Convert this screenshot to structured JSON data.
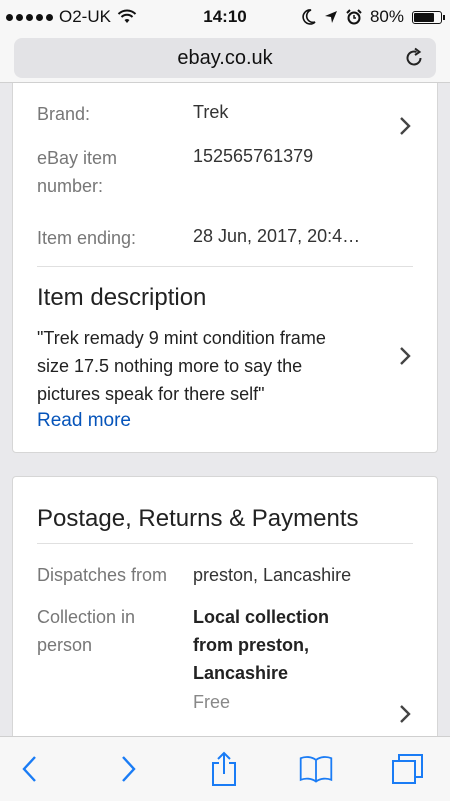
{
  "status": {
    "carrier": "O2-UK",
    "time": "14:10",
    "battery": "80%",
    "battery_level": 0.8
  },
  "browser": {
    "url": "ebay.co.uk"
  },
  "item_specifics": {
    "brand_label": "Brand:",
    "brand_value": "Trek",
    "item_number_label_line1": "eBay item",
    "item_number_label_line2": "number:",
    "item_number_value": "152565761379",
    "ending_label": "Item ending:",
    "ending_value": "28 Jun, 2017, 20:4…"
  },
  "description": {
    "title": "Item description",
    "line1": "\"Trek remady 9 mint condition frame",
    "line2": "size 17.5 nothing more to say the",
    "line3": "pictures speak for there self\"",
    "read_more": "Read more"
  },
  "postage": {
    "title": "Postage, Returns & Payments",
    "dispatch_label": "Dispatches from",
    "dispatch_value": "preston, Lancashire",
    "collection_label_line1": "Collection in",
    "collection_label_line2": "person",
    "collection_value_line1": "Local collection",
    "collection_value_line2": "from preston,",
    "collection_value_line3": "Lancashire",
    "collection_price": "Free"
  },
  "icons": {
    "wifi": "wifi-icon",
    "moon": "moon-icon",
    "location": "location-arrow-icon",
    "alarm": "alarm-icon",
    "reload": "reload-icon",
    "back": "back-icon",
    "forward": "forward-icon",
    "share": "share-icon",
    "bookmarks": "bookmarks-icon",
    "tabs": "tabs-icon"
  },
  "colors": {
    "link": "#0654ba",
    "ios_blue": "#1a7cf5"
  }
}
